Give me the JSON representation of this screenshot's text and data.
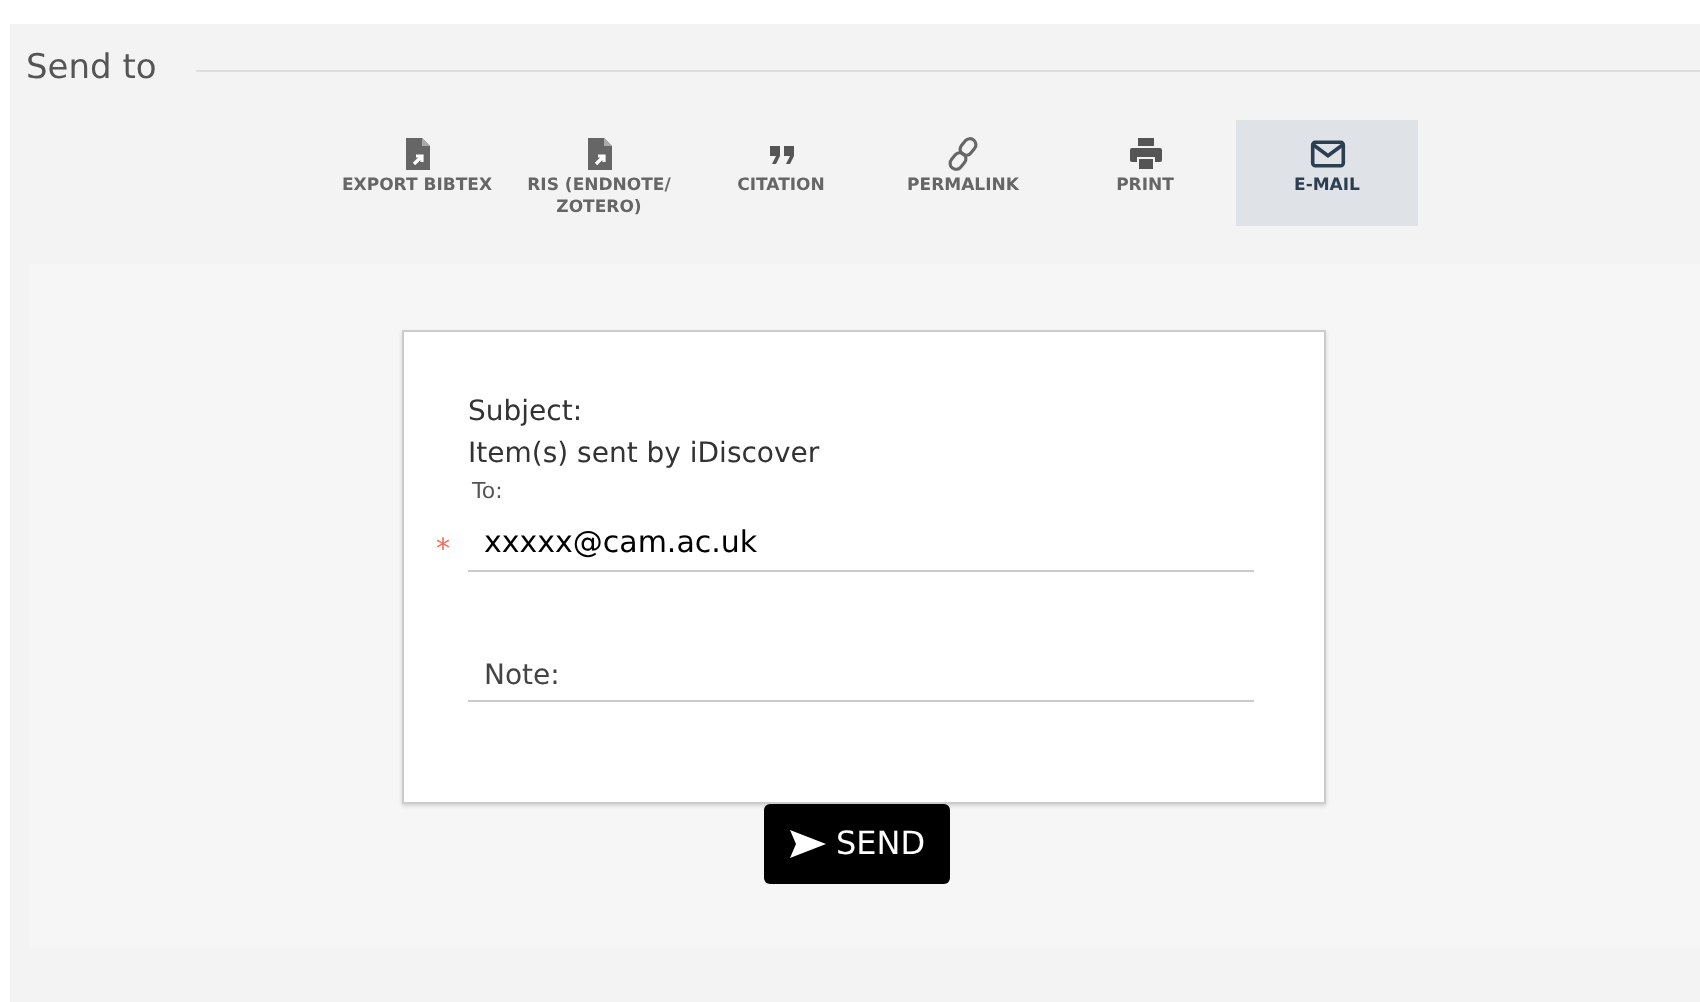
{
  "section": {
    "title": "Send to"
  },
  "actions": [
    {
      "kind": "bibtex",
      "label": "EXPORT BIBTEX",
      "selected": false
    },
    {
      "kind": "ris",
      "label": "RIS (ENDNOTE/ ZOTERO)",
      "selected": false
    },
    {
      "kind": "citation",
      "label": "CITATION",
      "selected": false
    },
    {
      "kind": "permalink",
      "label": "PERMALINK",
      "selected": false
    },
    {
      "kind": "print",
      "label": "PRINT",
      "selected": false
    },
    {
      "kind": "email",
      "label": "E-MAIL",
      "selected": true
    }
  ],
  "form": {
    "subject_label": "Subject:",
    "subject_value": "Item(s) sent by iDiscover",
    "to_label": "To:",
    "to_required": true,
    "required_mark": "*",
    "to_value": "xxxxx@cam.ac.uk",
    "note_placeholder": "Note:"
  },
  "send_button": {
    "label": "SEND"
  }
}
